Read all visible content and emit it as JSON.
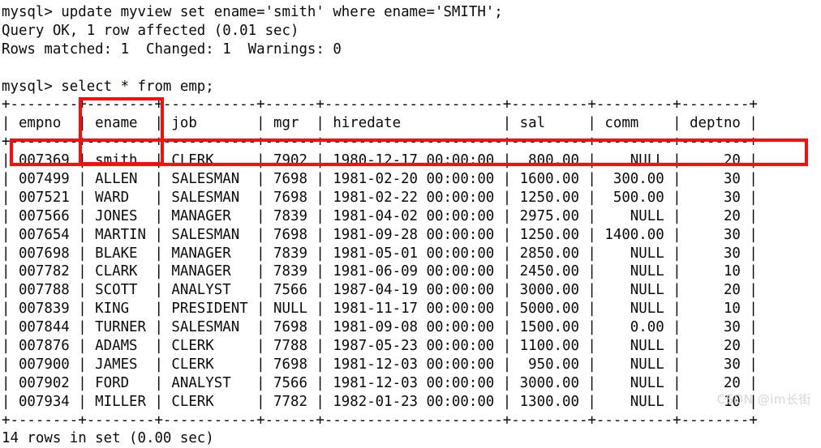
{
  "terminal": {
    "prompt": "mysql> ",
    "lines": [
      "mysql> update myview set ename='smith' where ename='SMITH';",
      "Query OK, 1 row affected (0.01 sec)",
      "Rows matched: 1  Changed: 1  Warnings: 0",
      "",
      "mysql> select * from emp;",
      "+--------+--------+-----------+------+---------------------+---------+---------+--------+",
      "| empno  | ename  | job       | mgr  | hiredate            | sal     | comm    | deptno |",
      "+--------+--------+-----------+------+---------------------+---------+---------+--------+",
      "| 007369 | smith  | CLERK     | 7902 | 1980-12-17 00:00:00 |  800.00 |    NULL |     20 |",
      "| 007499 | ALLEN  | SALESMAN  | 7698 | 1981-02-20 00:00:00 | 1600.00 |  300.00 |     30 |",
      "| 007521 | WARD   | SALESMAN  | 7698 | 1981-02-22 00:00:00 | 1250.00 |  500.00 |     30 |",
      "| 007566 | JONES  | MANAGER   | 7839 | 1981-04-02 00:00:00 | 2975.00 |    NULL |     20 |",
      "| 007654 | MARTIN | SALESMAN  | 7698 | 1981-09-28 00:00:00 | 1250.00 | 1400.00 |     30 |",
      "| 007698 | BLAKE  | MANAGER   | 7839 | 1981-05-01 00:00:00 | 2850.00 |    NULL |     30 |",
      "| 007782 | CLARK  | MANAGER   | 7839 | 1981-06-09 00:00:00 | 2450.00 |    NULL |     10 |",
      "| 007788 | SCOTT  | ANALYST   | 7566 | 1987-04-19 00:00:00 | 3000.00 |    NULL |     20 |",
      "| 007839 | KING   | PRESIDENT | NULL | 1981-11-17 00:00:00 | 5000.00 |    NULL |     10 |",
      "| 007844 | TURNER | SALESMAN  | 7698 | 1981-09-08 00:00:00 | 1500.00 |    0.00 |     30 |",
      "| 007876 | ADAMS  | CLERK     | 7788 | 1987-05-23 00:00:00 | 1100.00 |    NULL |     20 |",
      "| 007900 | JAMES  | CLERK     | 7698 | 1981-12-03 00:00:00 |  950.00 |    NULL |     30 |",
      "| 007902 | FORD   | ANALYST   | 7566 | 1981-12-03 00:00:00 | 3000.00 |    NULL |     20 |",
      "| 007934 | MILLER | CLERK     | 7782 | 1982-01-23 00:00:00 | 1300.00 |    NULL |     10 |",
      "+--------+--------+-----------+------+---------------------+---------+---------+--------+",
      "14 rows in set (0.00 sec)"
    ],
    "commands": {
      "update_statement": "update myview set ename='smith' where ename='SMITH';",
      "select_statement": "select * from emp;"
    },
    "status_messages": {
      "query_ok": "Query OK, 1 row affected (0.01 sec)",
      "rows_matched": "Rows matched: 1  Changed: 1  Warnings: 0",
      "rows_in_set": "14 rows in set (0.00 sec)"
    },
    "result_table": {
      "columns": [
        "empno",
        "ename",
        "job",
        "mgr",
        "hiredate",
        "sal",
        "comm",
        "deptno"
      ],
      "rows": [
        [
          "007369",
          "smith",
          "CLERK",
          "7902",
          "1980-12-17 00:00:00",
          "800.00",
          "NULL",
          "20"
        ],
        [
          "007499",
          "ALLEN",
          "SALESMAN",
          "7698",
          "1981-02-20 00:00:00",
          "1600.00",
          "300.00",
          "30"
        ],
        [
          "007521",
          "WARD",
          "SALESMAN",
          "7698",
          "1981-02-22 00:00:00",
          "1250.00",
          "500.00",
          "30"
        ],
        [
          "007566",
          "JONES",
          "MANAGER",
          "7839",
          "1981-04-02 00:00:00",
          "2975.00",
          "NULL",
          "20"
        ],
        [
          "007654",
          "MARTIN",
          "SALESMAN",
          "7698",
          "1981-09-28 00:00:00",
          "1250.00",
          "1400.00",
          "30"
        ],
        [
          "007698",
          "BLAKE",
          "MANAGER",
          "7839",
          "1981-05-01 00:00:00",
          "2850.00",
          "NULL",
          "30"
        ],
        [
          "007782",
          "CLARK",
          "MANAGER",
          "7839",
          "1981-06-09 00:00:00",
          "2450.00",
          "NULL",
          "10"
        ],
        [
          "007788",
          "SCOTT",
          "ANALYST",
          "7566",
          "1987-04-19 00:00:00",
          "3000.00",
          "NULL",
          "20"
        ],
        [
          "007839",
          "KING",
          "PRESIDENT",
          "NULL",
          "1981-11-17 00:00:00",
          "5000.00",
          "NULL",
          "10"
        ],
        [
          "007844",
          "TURNER",
          "SALESMAN",
          "7698",
          "1981-09-08 00:00:00",
          "1500.00",
          "0.00",
          "30"
        ],
        [
          "007876",
          "ADAMS",
          "CLERK",
          "7788",
          "1987-05-23 00:00:00",
          "1100.00",
          "NULL",
          "20"
        ],
        [
          "007900",
          "JAMES",
          "CLERK",
          "7698",
          "1981-12-03 00:00:00",
          "950.00",
          "NULL",
          "30"
        ],
        [
          "007902",
          "FORD",
          "ANALYST",
          "7566",
          "1981-12-03 00:00:00",
          "3000.00",
          "NULL",
          "20"
        ],
        [
          "007934",
          "MILLER",
          "CLERK",
          "7782",
          "1982-01-23 00:00:00",
          "1300.00",
          "NULL",
          "10"
        ]
      ],
      "row_count": 14
    }
  },
  "annotations": {
    "color": "#fb0d09",
    "ename_column_highlight": "ename",
    "updated_row_highlight": "007369 smith"
  },
  "watermark": {
    "text": "CSDN @im长街",
    "color": "#d7d7d7"
  }
}
